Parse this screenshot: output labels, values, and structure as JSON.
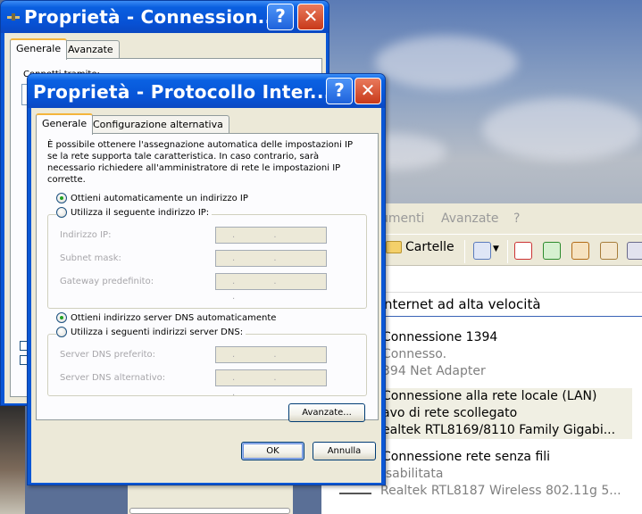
{
  "back_dialog": {
    "title": "Proprietà - Connession...",
    "tabs": [
      "Generale",
      "Avanzate"
    ],
    "peek_label": "Connetti tramite:",
    "help_glyph": "?",
    "close_glyph": "✕"
  },
  "front_dialog": {
    "title": "Proprietà - Protocollo Inter...",
    "help_glyph": "?",
    "close_glyph": "✕",
    "tabs": [
      "Generale",
      "Configurazione alternativa"
    ],
    "intro": "È possibile ottenere l'assegnazione automatica delle impostazioni IP se la rete supporta tale caratteristica. In caso contrario, sarà necessario richiedere all'amministratore di rete le impostazioni IP corrette.",
    "ip": {
      "auto_label": "Ottieni automaticamente un indirizzo IP",
      "manual_label": "Utilizza il seguente indirizzo IP:",
      "selected": "auto",
      "fields": [
        {
          "label": "Indirizzo IP:",
          "value": ". . ."
        },
        {
          "label": "Subnet mask:",
          "value": ". . ."
        },
        {
          "label": "Gateway predefinito:",
          "value": ". . ."
        }
      ]
    },
    "dns": {
      "auto_label": "Ottieni indirizzo server DNS automaticamente",
      "manual_label": "Utilizza i seguenti indirizzi server DNS:",
      "selected": "auto",
      "fields": [
        {
          "label": "Server DNS preferito:",
          "value": ". . ."
        },
        {
          "label": "Server DNS alternativo:",
          "value": ". . ."
        }
      ]
    },
    "advanced_button": "Avanzate...",
    "ok_button": "OK",
    "cancel_button": "Annulla"
  },
  "explorer": {
    "menu": [
      "umenti",
      "Avanzate",
      "?"
    ],
    "toolbar": {
      "folders_label": "Cartelle"
    },
    "group_title": "nternet ad alta velocità",
    "connections": [
      {
        "name": "Connessione 1394",
        "status": "Connesso.",
        "device": "394 Net Adapter"
      },
      {
        "name": "Connessione alla rete locale (LAN)",
        "status": "avo di rete scollegato",
        "device": "ealtek RTL8169/8110 Family Gigabi..."
      },
      {
        "name": "Connessione rete senza fili",
        "status": "isabilitata",
        "device": "Realtek RTL8187 Wireless 802.11g 5..."
      }
    ]
  },
  "colors": {
    "xp_title_blue": "#0753d6",
    "dialog_face": "#ece9d8",
    "close_red": "#c8391a",
    "radio_green": "#21a121",
    "tab_highlight": "#f4b53c"
  }
}
